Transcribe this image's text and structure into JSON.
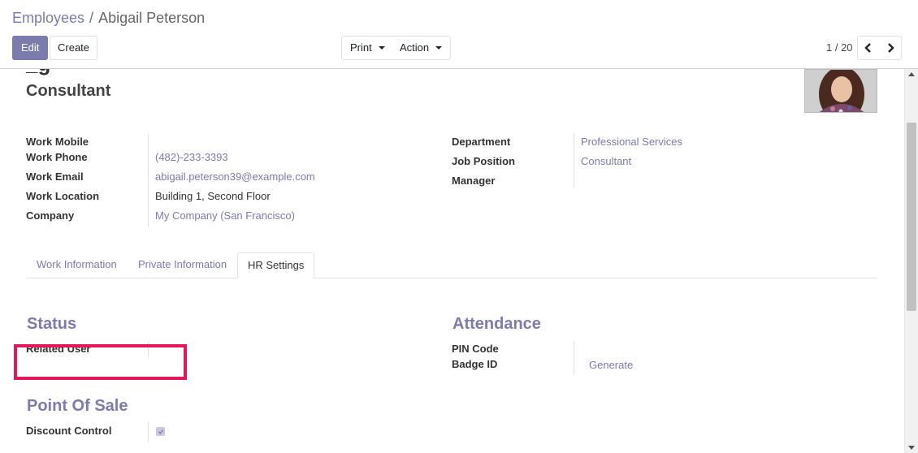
{
  "breadcrumb": {
    "parent": "Employees",
    "separator": "/",
    "current": "Abigail Peterson"
  },
  "toolbar": {
    "edit_label": "Edit",
    "create_label": "Create",
    "print_label": "Print",
    "action_label": "Action"
  },
  "pager": {
    "value": "1 / 20"
  },
  "employee": {
    "job_title": "Consultant",
    "left_fields": [
      {
        "label": "Work Mobile",
        "value": ""
      },
      {
        "label": "Work Phone",
        "value": "(482)-233-3393"
      },
      {
        "label": "Work Email",
        "value": "abigail.peterson39@example.com"
      },
      {
        "label": "Work Location",
        "value": "Building 1, Second Floor"
      },
      {
        "label": "Company",
        "value": "My Company (San Francisco)"
      }
    ],
    "right_fields": [
      {
        "label": "Department",
        "value": "Professional Services"
      },
      {
        "label": "Job Position",
        "value": "Consultant"
      },
      {
        "label": "Manager",
        "value": ""
      }
    ]
  },
  "tabs": [
    {
      "label": "Work Information",
      "active": false
    },
    {
      "label": "Private Information",
      "active": false
    },
    {
      "label": "HR Settings",
      "active": true
    }
  ],
  "hr_settings": {
    "status": {
      "title": "Status",
      "related_user_label": "Related User",
      "related_user_value": ""
    },
    "attendance": {
      "title": "Attendance",
      "pin_code_label": "PIN Code",
      "badge_id_label": "Badge ID",
      "generate_label": "Generate"
    },
    "point_of_sale": {
      "title": "Point Of Sale",
      "discount_control_label": "Discount Control",
      "discount_control_checked": true
    }
  },
  "colors": {
    "accent": "#7c7bad",
    "highlight": "#e3185a"
  },
  "icons": {
    "print_dropdown": "caret-down-icon",
    "action_dropdown": "caret-down-icon",
    "pager_prev": "chevron-left-icon",
    "pager_next": "chevron-right-icon"
  }
}
